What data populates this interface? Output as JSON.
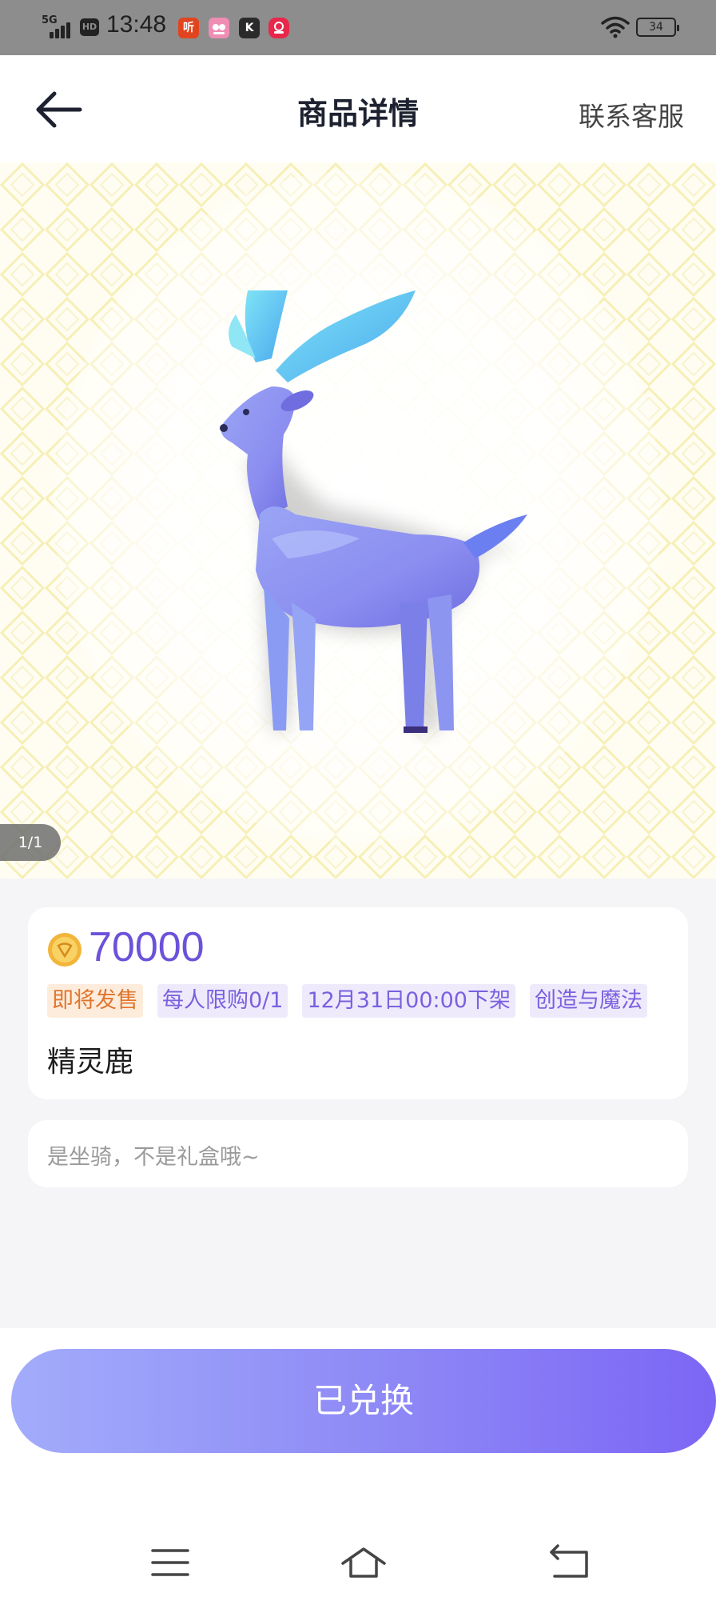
{
  "status_bar": {
    "network": "5G",
    "hd": "HD",
    "time": "13:48",
    "apps": [
      "听",
      "",
      "K",
      ""
    ],
    "battery": "34"
  },
  "header": {
    "title": "商品详情",
    "contact": "联系客服"
  },
  "gallery": {
    "indicator": "1/1"
  },
  "product": {
    "price": "70000",
    "tags": {
      "status": "即将发售",
      "limit": "每人限购0/1",
      "offline": "12月31日00:00下架",
      "category": "创造与魔法"
    },
    "name": "精灵鹿"
  },
  "note": "是坐骑，不是礼盒哦~",
  "action": {
    "button_label": "已兑换"
  },
  "colors": {
    "accent": "#6c52d9",
    "button_start": "#a2acfb",
    "button_end": "#7c66f5",
    "status_tag_text": "#e0752c"
  }
}
